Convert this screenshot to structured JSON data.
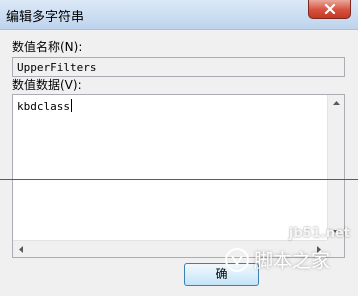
{
  "window": {
    "title": "编辑多字符串"
  },
  "form": {
    "value_name_label": "数值名称(N):",
    "value_name": "UpperFilters",
    "value_data_label": "数值数据(V):",
    "value_data": "kbdclass"
  },
  "buttons": {
    "ok_label": "确"
  },
  "watermark": {
    "url": "jb51.net",
    "brand": "脚本之家"
  },
  "colors": {
    "close_button": "#c94a36",
    "red_line": "#b03a2e",
    "ok_button_border": "#3c7fb1"
  }
}
